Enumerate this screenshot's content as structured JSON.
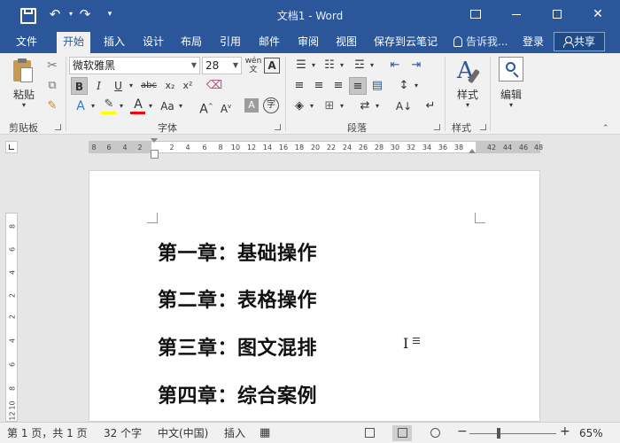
{
  "titlebar": {
    "doc_title": "文档1 - Word",
    "quick_access": {
      "redo_glyph": "↷",
      "undo_glyph": "↶",
      "customize_glyph": "▾"
    }
  },
  "tabs": [
    "文件",
    "开始",
    "插入",
    "设计",
    "布局",
    "引用",
    "邮件",
    "审阅",
    "视图",
    "保存到云笔记"
  ],
  "active_tab": "开始",
  "tell_me": "告诉我...",
  "login": "登录",
  "share": "共享",
  "ribbon": {
    "clipboard": {
      "label": "剪贴板",
      "paste": "粘贴"
    },
    "font": {
      "label": "字体",
      "font_name": "微软雅黑",
      "font_size": "28",
      "bold": "B",
      "italic": "I",
      "underline": "U",
      "strike": "abc",
      "subscript": "x₂",
      "superscript": "x²",
      "grow": "A",
      "shrink": "A",
      "change_case": "Aa",
      "char_shade": "A",
      "enclose": "字",
      "phonetic": "wén",
      "border_char": "A",
      "highlight_color": "#ffff00",
      "font_color": "#ff0000"
    },
    "paragraph": {
      "label": "段落"
    },
    "styles": {
      "label": "样式",
      "button": "样式"
    },
    "editing": {
      "button": "编辑"
    }
  },
  "ruler": {
    "h_left_margin": [
      "8",
      "6",
      "4",
      "2"
    ],
    "h_body": [
      "2",
      "4",
      "6",
      "8",
      "10",
      "12",
      "14",
      "16",
      "18",
      "20",
      "22",
      "24",
      "26",
      "28",
      "30",
      "32",
      "34",
      "36",
      "38"
    ],
    "h_right_margin": [
      "42",
      "44",
      "46",
      "48"
    ],
    "vertical": [
      "8",
      "6",
      "4",
      "2",
      "2",
      "4",
      "6",
      "8",
      "10",
      "12"
    ]
  },
  "document": {
    "headings": [
      "第一章：基础操作",
      "第二章：表格操作",
      "第三章：图文混排",
      "第四章：综合案例"
    ]
  },
  "statusbar": {
    "page_info": "第 1 页，共 1 页",
    "word_count": "32 个字",
    "language": "中文(中国)",
    "mode": "插入",
    "zoom_minus": "−",
    "zoom_plus": "+",
    "zoom": "65%"
  }
}
